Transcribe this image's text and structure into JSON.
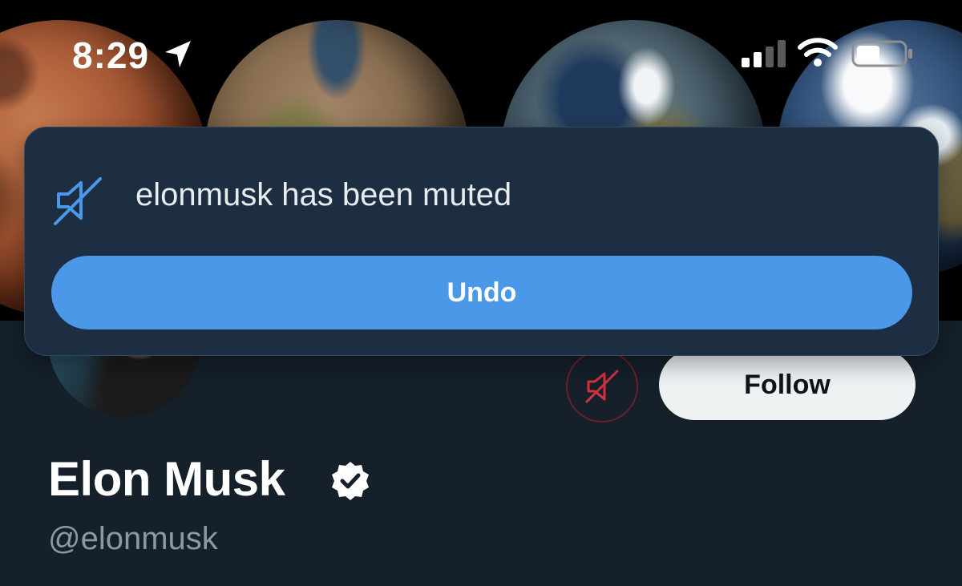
{
  "status_bar": {
    "time": "8:29",
    "location_icon": "location-arrow-icon",
    "signal_icon": "cellular-signal-icon",
    "wifi_icon": "wifi-icon",
    "battery_icon": "battery-icon"
  },
  "banner": {
    "description_icon": "planets-banner"
  },
  "toast": {
    "icon": "mute-icon",
    "message": "elonmusk has been muted",
    "undo_label": "Undo"
  },
  "profile": {
    "display_name": "Elon Musk",
    "handle": "@elonmusk",
    "verified_icon": "verified-badge-icon",
    "mute_icon": "muted-icon",
    "follow_label": "Follow"
  },
  "colors": {
    "background": "#15202b",
    "toast_background": "#1d2e42",
    "accent_blue": "#4b98e8",
    "muted_red": "#d3313f",
    "handle_gray": "#8b98a5"
  }
}
